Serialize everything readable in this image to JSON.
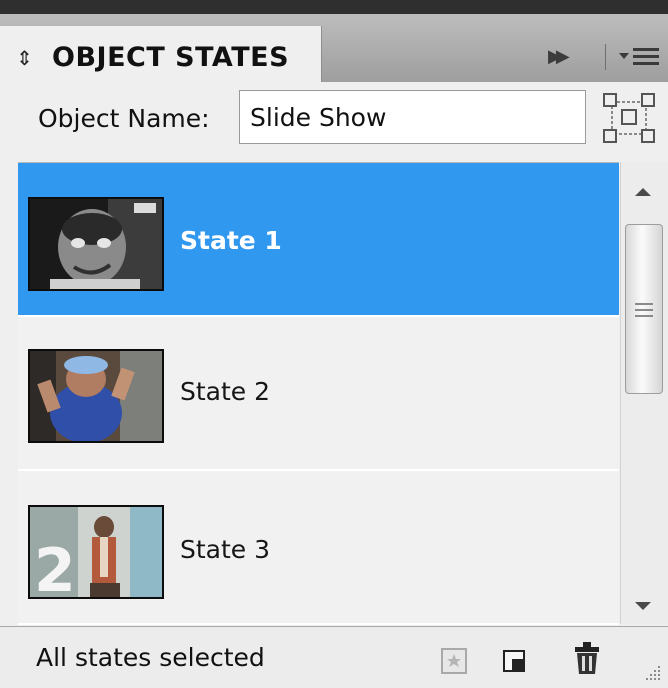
{
  "panel": {
    "tab_arrows": "⬍",
    "tab_title": "OBJECT STATES",
    "collapse_icon": "▸▸"
  },
  "object": {
    "label": "Object Name:",
    "value": "Slide Show"
  },
  "states": [
    {
      "label": "State 1",
      "selected": true
    },
    {
      "label": "State 2",
      "selected": false
    },
    {
      "label": "State 3",
      "selected": false
    }
  ],
  "footer": {
    "status": "All states selected"
  },
  "colors": {
    "selection": "#3198ef",
    "panel_bg": "#efefef"
  },
  "icons": [
    "panel-collapse-icon",
    "panel-menu-icon",
    "object-bounds-icon",
    "new-state-icon",
    "delete-state-icon",
    "trash-icon",
    "resize-grip-icon"
  ]
}
